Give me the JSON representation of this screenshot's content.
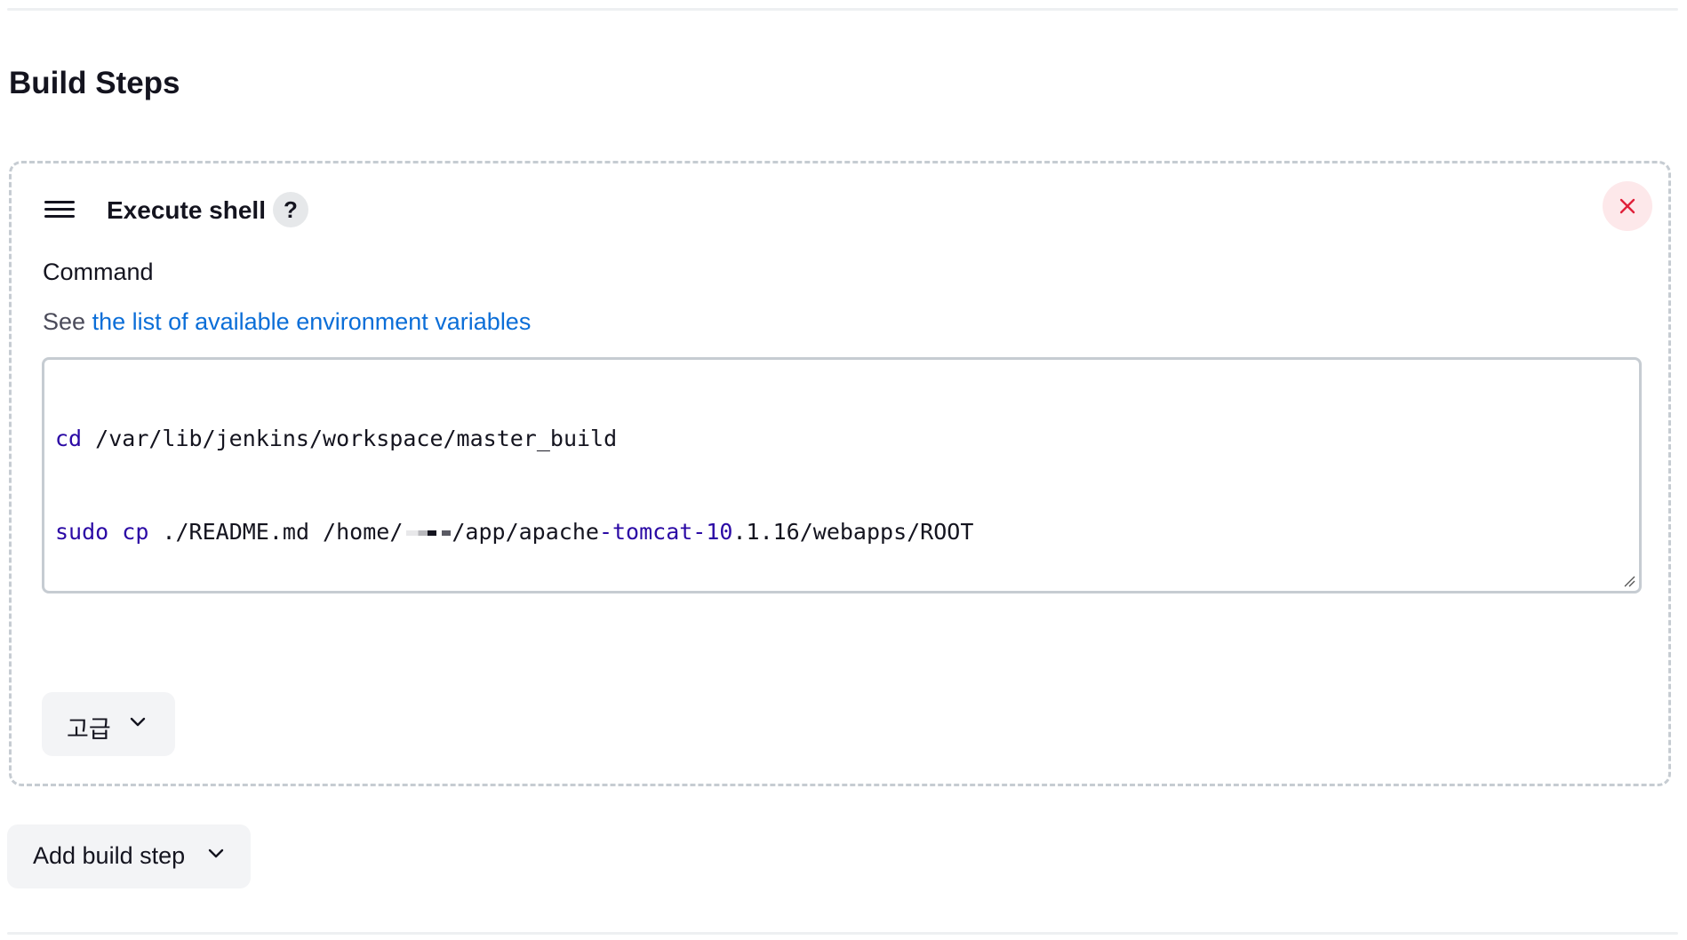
{
  "section": {
    "title": "Build Steps"
  },
  "step": {
    "title": "Execute shell",
    "help_label": "?",
    "field_label": "Command",
    "help_prefix": "See",
    "help_link": "the list of available environment variables",
    "command": {
      "line1_cmd": "cd",
      "line1_rest": " /var/lib/jenkins/workspace/master_build",
      "line2_sudo": "sudo",
      "line2_cp": "cp",
      "line2_path_a": " ./README.md /home/",
      "line2_path_b": "/app/apache",
      "line2_highlight": "-tomcat-10",
      "line2_path_c": ".1.16/webapps/ROOT"
    },
    "advanced_label": "고급"
  },
  "add_step": {
    "label": "Add build step"
  },
  "colors": {
    "link": "#0b6ed8",
    "keyword": "#2b0aa5",
    "delete_icon": "#e0203a",
    "delete_bg": "#fde8ea"
  },
  "icons": {
    "drag": "drag-handle-icon",
    "close": "close-icon",
    "chevron": "chevron-down-icon"
  }
}
